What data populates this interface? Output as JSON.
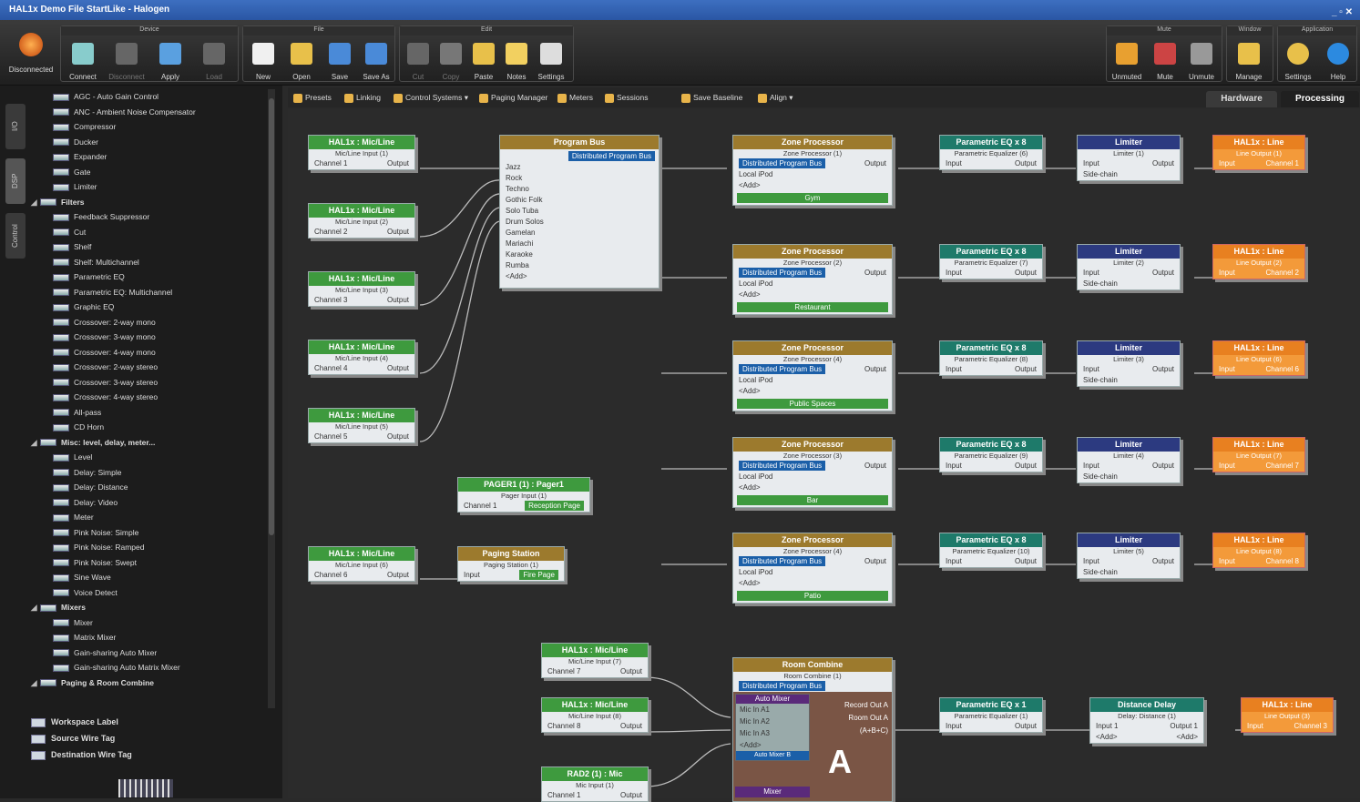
{
  "title": "HAL1x Demo File StartLike - Halogen",
  "ribbon": {
    "groups": [
      {
        "title": "Device",
        "buttons": [
          "Connect",
          "Disconnect",
          "Apply",
          "Load"
        ]
      },
      {
        "title": "File",
        "buttons": [
          "New",
          "Open",
          "Save",
          "Save As"
        ]
      },
      {
        "title": "Edit",
        "buttons": [
          "Cut",
          "Copy",
          "Paste",
          "Notes",
          "Settings"
        ]
      },
      {
        "title": "Mute",
        "buttons": [
          "Unmuted",
          "Mute",
          "Unmute"
        ]
      },
      {
        "title": "Window",
        "buttons": [
          "Manage"
        ]
      },
      {
        "title": "Application",
        "buttons": [
          "Settings",
          "Help"
        ]
      }
    ],
    "status": "Disconnected"
  },
  "left_tabs": [
    "I/O",
    "DSP",
    "Control"
  ],
  "tree": [
    {
      "label": "AGC - Auto Gain Control",
      "cat": false
    },
    {
      "label": "ANC - Ambient Noise Compensator",
      "cat": false
    },
    {
      "label": "Compressor",
      "cat": false
    },
    {
      "label": "Ducker",
      "cat": false
    },
    {
      "label": "Expander",
      "cat": false
    },
    {
      "label": "Gate",
      "cat": false
    },
    {
      "label": "Limiter",
      "cat": false
    },
    {
      "label": "Filters",
      "cat": true
    },
    {
      "label": "Feedback Suppressor",
      "cat": false
    },
    {
      "label": "Cut",
      "cat": false
    },
    {
      "label": "Shelf",
      "cat": false
    },
    {
      "label": "Shelf: Multichannel",
      "cat": false
    },
    {
      "label": "Parametric EQ",
      "cat": false
    },
    {
      "label": "Parametric EQ: Multichannel",
      "cat": false
    },
    {
      "label": "Graphic EQ",
      "cat": false
    },
    {
      "label": "Crossover: 2-way mono",
      "cat": false
    },
    {
      "label": "Crossover: 3-way mono",
      "cat": false
    },
    {
      "label": "Crossover: 4-way mono",
      "cat": false
    },
    {
      "label": "Crossover: 2-way stereo",
      "cat": false
    },
    {
      "label": "Crossover: 3-way stereo",
      "cat": false
    },
    {
      "label": "Crossover: 4-way stereo",
      "cat": false
    },
    {
      "label": "All-pass",
      "cat": false
    },
    {
      "label": "CD Horn",
      "cat": false
    },
    {
      "label": "Misc: level, delay, meter...",
      "cat": true
    },
    {
      "label": "Level",
      "cat": false
    },
    {
      "label": "Delay: Simple",
      "cat": false
    },
    {
      "label": "Delay: Distance",
      "cat": false
    },
    {
      "label": "Delay: Video",
      "cat": false
    },
    {
      "label": "Meter",
      "cat": false
    },
    {
      "label": "Pink Noise: Simple",
      "cat": false
    },
    {
      "label": "Pink Noise: Ramped",
      "cat": false
    },
    {
      "label": "Pink Noise: Swept",
      "cat": false
    },
    {
      "label": "Sine Wave",
      "cat": false
    },
    {
      "label": "Voice Detect",
      "cat": false
    },
    {
      "label": "Mixers",
      "cat": true
    },
    {
      "label": "Mixer",
      "cat": false
    },
    {
      "label": "Matrix Mixer",
      "cat": false
    },
    {
      "label": "Gain-sharing Auto Mixer",
      "cat": false
    },
    {
      "label": "Gain-sharing Auto Matrix Mixer",
      "cat": false
    },
    {
      "label": "Paging & Room Combine",
      "cat": true
    }
  ],
  "legend": [
    "Workspace Label",
    "Source Wire Tag",
    "Destination Wire Tag"
  ],
  "canvas_toolbar": [
    "Presets",
    "Linking",
    "Control Systems",
    "Paging Manager",
    "Meters",
    "Sessions",
    "Save Baseline",
    "Align"
  ],
  "view_tabs": [
    "Hardware",
    "Processing"
  ],
  "inputs": [
    {
      "title": "HAL1x : Mic/Line",
      "sub": "Mic/Line Input (1)",
      "ch": "Channel 1",
      "out": "Output"
    },
    {
      "title": "HAL1x : Mic/Line",
      "sub": "Mic/Line Input (2)",
      "ch": "Channel 2",
      "out": "Output"
    },
    {
      "title": "HAL1x : Mic/Line",
      "sub": "Mic/Line Input (3)",
      "ch": "Channel 3",
      "out": "Output"
    },
    {
      "title": "HAL1x : Mic/Line",
      "sub": "Mic/Line Input (4)",
      "ch": "Channel 4",
      "out": "Output"
    },
    {
      "title": "HAL1x : Mic/Line",
      "sub": "Mic/Line Input (5)",
      "ch": "Channel 5",
      "out": "Output"
    },
    {
      "title": "HAL1x : Mic/Line",
      "sub": "Mic/Line Input (6)",
      "ch": "Channel 6",
      "out": "Output"
    }
  ],
  "program_bus": {
    "title": "Program Bus",
    "tag": "Distributed Program Bus",
    "items": [
      "Jazz",
      "Rock",
      "Techno",
      "Gothic Folk",
      "Solo Tuba",
      "Drum Solos",
      "Gamelan",
      "Mariachi",
      "Karaoke",
      "Rumba",
      "<Add>"
    ]
  },
  "pager": {
    "title": "PAGER1 (1) : Pager1",
    "sub": "Pager Input (1)",
    "ch": "Channel 1",
    "tag": "Reception Page"
  },
  "paging_station": {
    "title": "Paging Station",
    "sub": "Paging Station (1)",
    "in": "Input",
    "tag": "Fire Page"
  },
  "zones": [
    {
      "title": "Zone Processor",
      "sub": "Zone Processor (1)",
      "bus": "Distributed Program Bus",
      "local": "Local iPod",
      "add": "<Add>",
      "out": "Output",
      "tag": "Gym"
    },
    {
      "title": "Zone Processor",
      "sub": "Zone Processor (2)",
      "bus": "Distributed Program Bus",
      "local": "Local iPod",
      "add": "<Add>",
      "out": "Output",
      "tag": "Restaurant"
    },
    {
      "title": "Zone Processor",
      "sub": "Zone Processor (4)",
      "bus": "Distributed Program Bus",
      "local": "Local iPod",
      "add": "<Add>",
      "out": "Output",
      "tag": "Public Spaces"
    },
    {
      "title": "Zone Processor",
      "sub": "Zone Processor (3)",
      "bus": "Distributed Program Bus",
      "local": "Local iPod",
      "add": "<Add>",
      "out": "Output",
      "tag": "Bar"
    },
    {
      "title": "Zone Processor",
      "sub": "Zone Processor (4)",
      "bus": "Distributed Program Bus",
      "local": "Local iPod",
      "add": "<Add>",
      "out": "Output",
      "tag": "Patio"
    }
  ],
  "peqs": [
    {
      "title": "Parametric EQ x 8",
      "sub": "Parametric Equalizer (6)",
      "in": "Input",
      "out": "Output"
    },
    {
      "title": "Parametric EQ x 8",
      "sub": "Parametric Equalizer (7)",
      "in": "Input",
      "out": "Output"
    },
    {
      "title": "Parametric EQ x 8",
      "sub": "Parametric Equalizer (8)",
      "in": "Input",
      "out": "Output"
    },
    {
      "title": "Parametric EQ x 8",
      "sub": "Parametric Equalizer (9)",
      "in": "Input",
      "out": "Output"
    },
    {
      "title": "Parametric EQ x 8",
      "sub": "Parametric Equalizer (10)",
      "in": "Input",
      "out": "Output"
    }
  ],
  "limiters": [
    {
      "title": "Limiter",
      "sub": "Limiter (1)",
      "in": "Input",
      "out": "Output",
      "sc": "Side-chain"
    },
    {
      "title": "Limiter",
      "sub": "Limiter (2)",
      "in": "Input",
      "out": "Output",
      "sc": "Side-chain"
    },
    {
      "title": "Limiter",
      "sub": "Limiter (3)",
      "in": "Input",
      "out": "Output",
      "sc": "Side-chain"
    },
    {
      "title": "Limiter",
      "sub": "Limiter (4)",
      "in": "Input",
      "out": "Output",
      "sc": "Side-chain"
    },
    {
      "title": "Limiter",
      "sub": "Limiter (5)",
      "in": "Input",
      "out": "Output",
      "sc": "Side-chain"
    }
  ],
  "outputs": [
    {
      "title": "HAL1x : Line",
      "sub": "Line Output (1)",
      "in": "Input",
      "ch": "Channel 1"
    },
    {
      "title": "HAL1x : Line",
      "sub": "Line Output (2)",
      "in": "Input",
      "ch": "Channel 2"
    },
    {
      "title": "HAL1x : Line",
      "sub": "Line Output (6)",
      "in": "Input",
      "ch": "Channel 6"
    },
    {
      "title": "HAL1x : Line",
      "sub": "Line Output (7)",
      "in": "Input",
      "ch": "Channel 7"
    },
    {
      "title": "HAL1x : Line",
      "sub": "Line Output (8)",
      "in": "Input",
      "ch": "Channel 8"
    }
  ],
  "bottom_inputs": [
    {
      "title": "HAL1x : Mic/Line",
      "sub": "Mic/Line Input (7)",
      "ch": "Channel 7",
      "out": "Output"
    },
    {
      "title": "HAL1x : Mic/Line",
      "sub": "Mic/Line Input (8)",
      "ch": "Channel 8",
      "out": "Output"
    },
    {
      "title": "RAD2 (1) : Mic",
      "sub": "Mic Input (1)",
      "ch": "Channel 1",
      "out": "Output"
    }
  ],
  "room_combine": {
    "title": "Room Combine",
    "sub": "Room Combine (1)",
    "bus": "Distributed Program Bus",
    "automixer": "Auto Mixer",
    "mics": [
      "Mic In A1",
      "Mic In A2",
      "Mic In A3",
      "<Add>"
    ],
    "outs": [
      "Record Out A",
      "Room Out A",
      "(A+B+C)"
    ],
    "room_label": "A",
    "mixer": "Mixer",
    "tag2": "Auto Mixer B"
  },
  "bottom_peq": {
    "title": "Parametric EQ x 1",
    "sub": "Parametric Equalizer (1)",
    "in": "Input",
    "out": "Output"
  },
  "distance_delay": {
    "title": "Distance Delay",
    "sub": "Delay: Distance (1)",
    "in": "Input 1",
    "out": "Output 1",
    "add1": "<Add>",
    "add2": "<Add>"
  },
  "bottom_output": {
    "title": "HAL1x : Line",
    "sub": "Line Output (3)",
    "in": "Input",
    "ch": "Channel 3"
  }
}
